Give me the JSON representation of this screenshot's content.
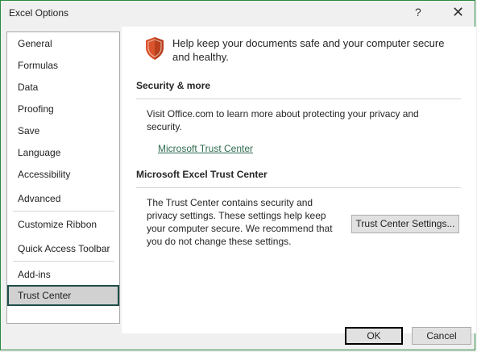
{
  "window": {
    "title": "Excel Options",
    "help_glyph": "?",
    "close_glyph": "✕"
  },
  "sidebar": {
    "items": [
      {
        "label": "General"
      },
      {
        "label": "Formulas"
      },
      {
        "label": "Data"
      },
      {
        "label": "Proofing"
      },
      {
        "label": "Save"
      },
      {
        "label": "Language"
      },
      {
        "label": "Accessibility"
      },
      {
        "label": "Advanced"
      },
      {
        "label": "Customize Ribbon"
      },
      {
        "label": "Quick Access Toolbar"
      },
      {
        "label": "Add-ins"
      },
      {
        "label": "Trust Center"
      }
    ],
    "selected": "Trust Center"
  },
  "content": {
    "intro": "Help keep your documents safe and your computer secure and healthy.",
    "shield_icon": "shield-icon",
    "security_section": {
      "title": "Security & more",
      "text": "Visit Office.com to learn more about protecting your privacy and security.",
      "link": "Microsoft Trust Center"
    },
    "trust_section": {
      "title": "Microsoft Excel Trust Center",
      "text": "The Trust Center contains security and privacy settings. These settings help keep your computer secure. We recommend that you do not change these settings.",
      "button": "Trust Center Settings..."
    }
  },
  "footer": {
    "ok": "OK",
    "cancel": "Cancel"
  },
  "colors": {
    "accent_border": "#2b8a3e",
    "shield": "#d9532b",
    "link": "#2e6b4f",
    "selected_border": "#1f4e4a"
  }
}
